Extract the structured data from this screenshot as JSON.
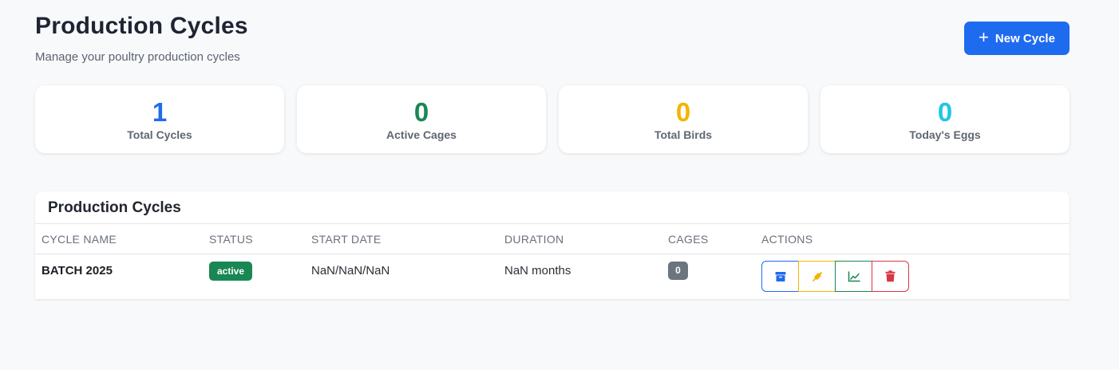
{
  "header": {
    "title": "Production Cycles",
    "subtitle": "Manage your poultry production cycles",
    "new_button_label": "New Cycle"
  },
  "stats": [
    {
      "value": "1",
      "label": "Total Cycles",
      "color": "#1f6bf0"
    },
    {
      "value": "0",
      "label": "Active Cages",
      "color": "#198754"
    },
    {
      "value": "0",
      "label": "Total Birds",
      "color": "#f5b400"
    },
    {
      "value": "0",
      "label": "Today's Eggs",
      "color": "#1fc6e8"
    }
  ],
  "table": {
    "title": "Production Cycles",
    "columns": [
      "CYCLE NAME",
      "STATUS",
      "START DATE",
      "DURATION",
      "CAGES",
      "ACTIONS"
    ],
    "rows": [
      {
        "cycle_name": "BATCH 2025",
        "status": "active",
        "start_date": "NaN/NaN/NaN",
        "duration": "NaN months",
        "cages": "0",
        "actions": [
          "archive-icon",
          "wheat-icon",
          "chart-line-icon",
          "trash-icon"
        ]
      }
    ]
  },
  "colors": {
    "primary": "#1f6bf0",
    "success": "#198754",
    "warning": "#f5b400",
    "info": "#1fc6e8",
    "danger": "#dc3545",
    "secondary": "#6c757d"
  }
}
